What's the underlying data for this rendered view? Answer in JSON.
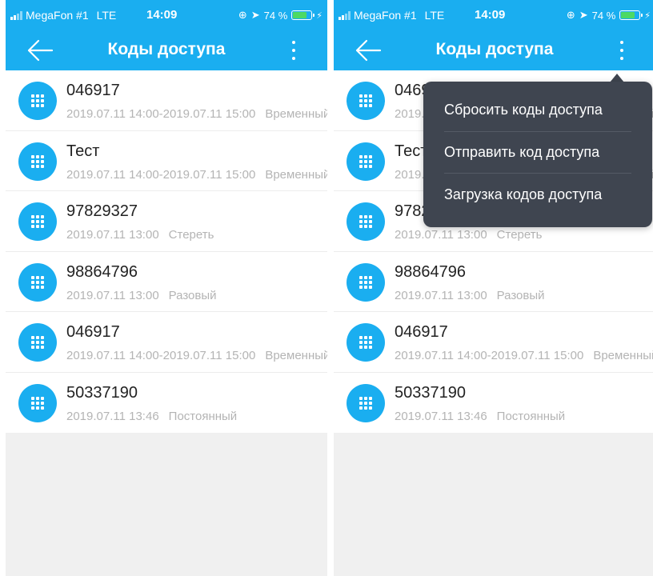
{
  "status_bar": {
    "carrier": "MegaFon #1",
    "network": "LTE",
    "time": "14:09",
    "battery": "74 %",
    "battery_level": 0.74
  },
  "header": {
    "title": "Коды доступа",
    "back_icon": "arrow-left-icon",
    "more_icon": "vertical-dots-icon"
  },
  "codes": [
    {
      "code": "046917",
      "date": "2019.07.11 14:00-2019.07.11 15:00",
      "type": "Временный"
    },
    {
      "code": "Тест",
      "date": "2019.07.11 14:00-2019.07.11 15:00",
      "type": "Временный"
    },
    {
      "code": "97829327",
      "date": "2019.07.11 13:00",
      "type": "Стереть"
    },
    {
      "code": "98864796",
      "date": "2019.07.11 13:00",
      "type": "Разовый"
    },
    {
      "code": "046917",
      "date": "2019.07.11 14:00-2019.07.11 15:00",
      "type": "Временный"
    },
    {
      "code": "50337190",
      "date": "2019.07.11 13:46",
      "type": "Постоянный"
    }
  ],
  "menu": {
    "items": [
      "Сбросить коды доступа",
      "Отправить код доступа",
      "Загрузка кодов доступа"
    ]
  },
  "colors": {
    "accent": "#1aaef0",
    "menu_bg": "#3f4550",
    "battery": "#4cd964"
  }
}
